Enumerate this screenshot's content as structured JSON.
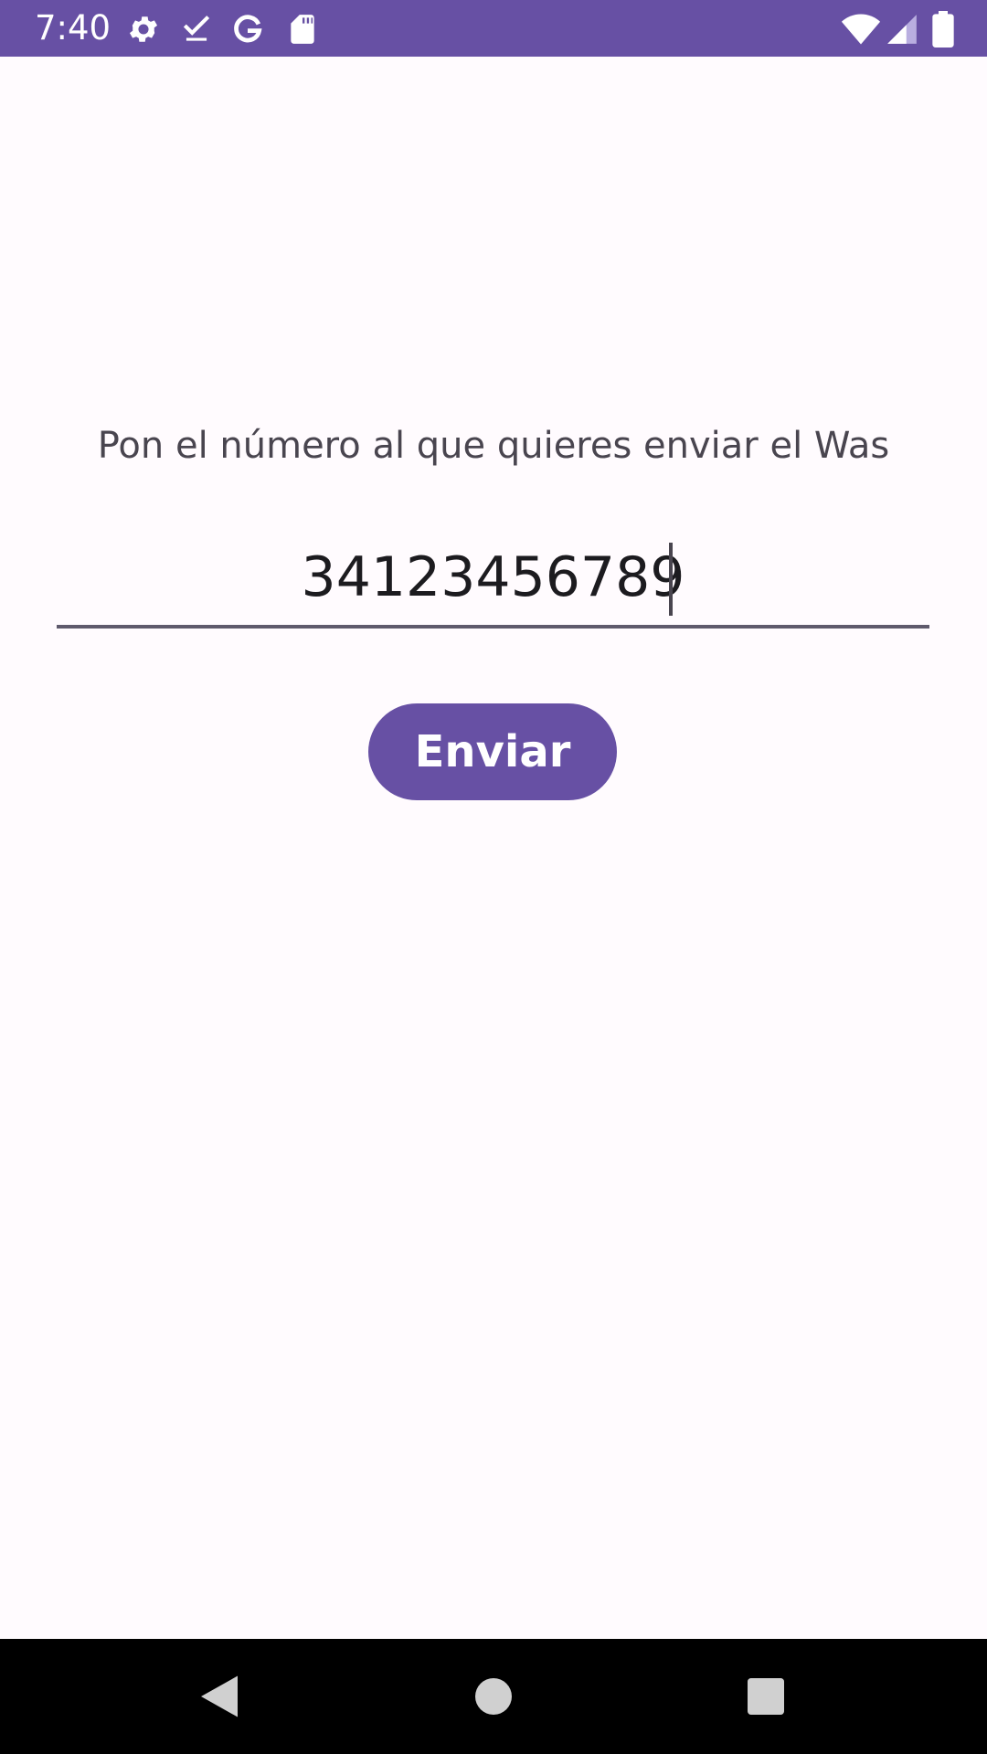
{
  "status_bar": {
    "time": "7:40",
    "background_color": "#6750a4",
    "left_icons": [
      "gear-icon",
      "download-done-icon",
      "google-icon",
      "sd-card-icon"
    ],
    "right_icons": [
      "wifi-icon",
      "cellular-signal-icon",
      "battery-icon"
    ]
  },
  "main": {
    "prompt": "Pon el número al que quieres enviar el Was",
    "phone_input": {
      "value": "34123456789"
    },
    "send_button": {
      "label": "Enviar",
      "color": "#6750a4"
    }
  },
  "nav_bar": {
    "buttons": [
      "back-icon",
      "home-icon",
      "recents-icon"
    ]
  }
}
